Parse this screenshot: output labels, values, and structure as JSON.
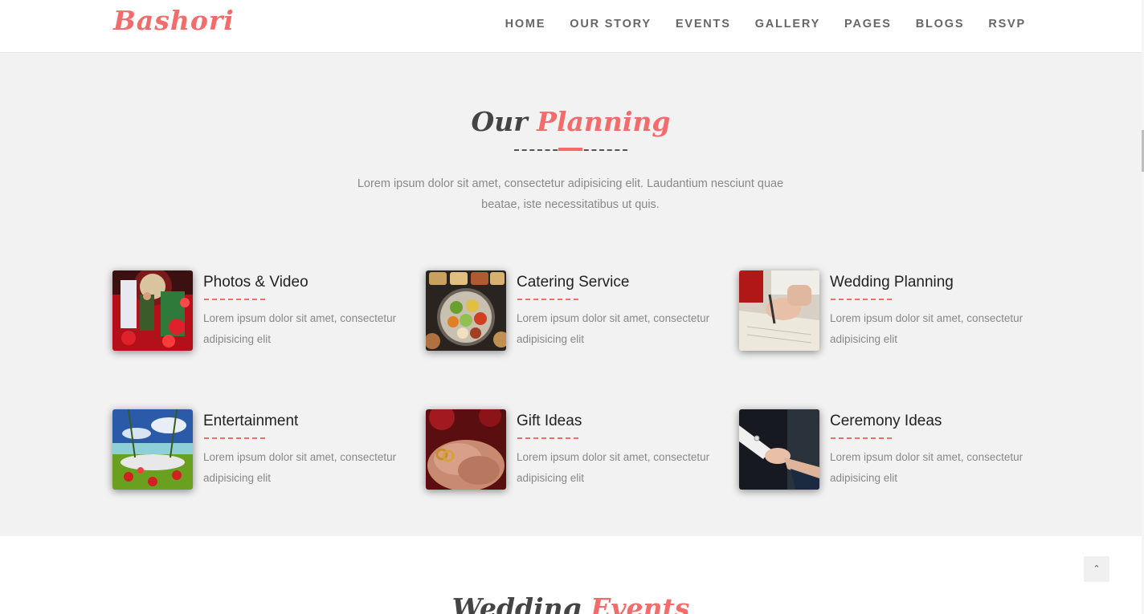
{
  "header": {
    "logo": "Bashori",
    "nav": [
      "HOME",
      "OUR STORY",
      "EVENTS",
      "GALLERY",
      "PAGES",
      "BLOGS",
      "RSVP"
    ]
  },
  "planning": {
    "title_dark": "Our",
    "title_accent": "Planning",
    "intro": "Lorem ipsum dolor sit amet, consectetur adipisicing elit. Laudantium nesciunt quae beataе, iste necessitatibus ut quis.",
    "services": [
      {
        "title": "Photos & Video",
        "desc": "Lorem ipsum dolor sit amet, consectetur adipisicing elit"
      },
      {
        "title": "Catering Service",
        "desc": "Lorem ipsum dolor sit amet, consectetur adipisicing elit"
      },
      {
        "title": "Wedding Planning",
        "desc": "Lorem ipsum dolor sit amet, consectetur adipisicing elit"
      },
      {
        "title": "Entertainment",
        "desc": "Lorem ipsum dolor sit amet, consectetur adipisicing elit"
      },
      {
        "title": "Gift Ideas",
        "desc": "Lorem ipsum dolor sit amet, consectetur adipisicing elit"
      },
      {
        "title": "Ceremony Ideas",
        "desc": "Lorem ipsum dolor sit amet, consectetur adipisicing elit"
      }
    ]
  },
  "events": {
    "title_dark": "Wedding",
    "title_accent": "Events"
  },
  "scroll_top": {
    "icon": "chevron-up-icon"
  },
  "colors": {
    "accent": "#f36b6b",
    "section_bg": "#f2f2f2",
    "text_muted": "#888888"
  }
}
